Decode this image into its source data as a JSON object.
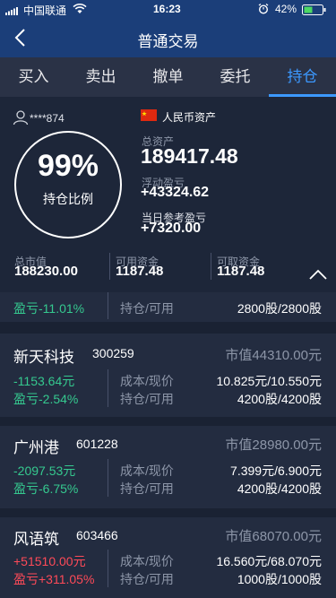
{
  "status_bar": {
    "carrier": "中国联通",
    "time": "16:23",
    "battery": "42%"
  },
  "nav": {
    "title": "普通交易"
  },
  "tabs": [
    {
      "label": "买入"
    },
    {
      "label": "卖出"
    },
    {
      "label": "撤单"
    },
    {
      "label": "委托"
    },
    {
      "label": "持仓"
    }
  ],
  "active_tab": 4,
  "account": {
    "masked_id": "****874",
    "currency_label": "人民币资产"
  },
  "position_ratio": {
    "value": "99%",
    "label": "持仓比例"
  },
  "total_assets": {
    "label": "总资产",
    "value": "189417.48"
  },
  "floating_pnl": {
    "label": "浮动盈亏",
    "value": "+43324.62"
  },
  "daily_pnl": {
    "label": "当日参考盈亏",
    "value": "+7320.00"
  },
  "balances": [
    {
      "label": "总市值",
      "value": "188230.00"
    },
    {
      "label": "可用资金",
      "value": "1187.48"
    },
    {
      "label": "可取资金",
      "value": "1187.48"
    }
  ],
  "partial_row": {
    "pnl_pct": "盈亏-11.01%",
    "shares_label": "持仓/可用",
    "shares": "2800股/2800股"
  },
  "holdings": [
    {
      "name": "新天科技",
      "code": "300259",
      "market_value": "市值44310.00元",
      "pnl": "-1153.64元",
      "pnl_pct": "盈亏-2.54%",
      "cost_label": "成本/现价",
      "cost": "10.825元/10.550元",
      "shares_label": "持仓/可用",
      "shares": "4200股/4200股",
      "positive": false
    },
    {
      "name": "广州港",
      "code": "601228",
      "market_value": "市值28980.00元",
      "pnl": "-2097.53元",
      "pnl_pct": "盈亏-6.75%",
      "cost_label": "成本/现价",
      "cost": "7.399元/6.900元",
      "shares_label": "持仓/可用",
      "shares": "4200股/4200股",
      "positive": false
    },
    {
      "name": "风语筑",
      "code": "603466",
      "market_value": "市值68070.00元",
      "pnl": "+51510.00元",
      "pnl_pct": "盈亏+311.05%",
      "cost_label": "成本/现价",
      "cost": "16.560元/68.070元",
      "shares_label": "持仓/可用",
      "shares": "1000股/1000股",
      "positive": true
    }
  ],
  "colors": {
    "accent": "#3c99ff",
    "loss": "#35c98f",
    "gain": "#ff4a58",
    "nav_bg": "#1b3e79"
  }
}
